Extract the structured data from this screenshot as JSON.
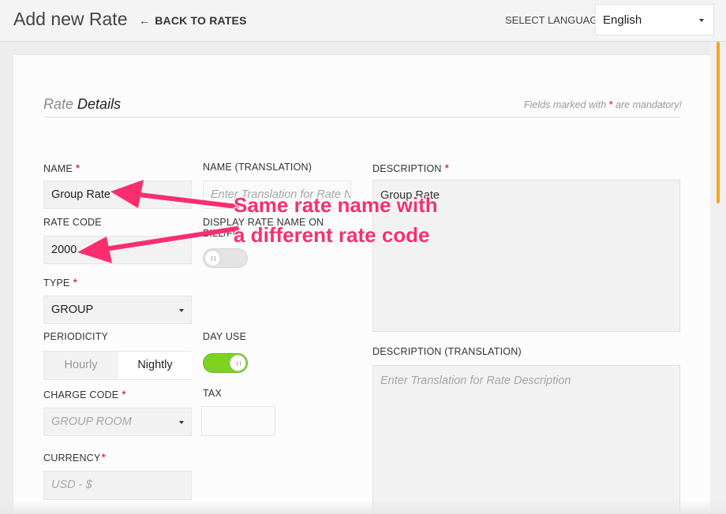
{
  "header": {
    "title": "Add new Rate",
    "back_label": "BACK TO RATES",
    "language_label": "SELECT LANGUAGE",
    "language_value": "English"
  },
  "section": {
    "title_light": "Rate",
    "title_bold": "Details",
    "mandatory_prefix": "Fields marked with",
    "mandatory_star": "*",
    "mandatory_suffix": "are mandatory!"
  },
  "form": {
    "name": {
      "label": "NAME",
      "value": "Group Rate"
    },
    "name_translation": {
      "label": "NAME (TRANSLATION)",
      "placeholder": "Enter Translation for Rate Na"
    },
    "rate_code": {
      "label": "RATE CODE",
      "value": "2000"
    },
    "display_rate_name": {
      "label_line1": "DISPLAY RATE NAME ON",
      "label_line2": "BILL/FO",
      "enabled": false
    },
    "type": {
      "label": "TYPE",
      "value": "GROUP"
    },
    "periodicity": {
      "label": "PERIODICITY",
      "options": [
        "Hourly",
        "Nightly"
      ],
      "selected": "Nightly"
    },
    "day_use": {
      "label": "DAY USE",
      "enabled": true
    },
    "charge_code": {
      "label": "CHARGE CODE",
      "placeholder": "GROUP ROOM"
    },
    "tax": {
      "label": "TAX",
      "value": ""
    },
    "currency": {
      "label": "CURRENCY",
      "placeholder": "USD - $"
    },
    "description": {
      "label": "DESCRIPTION",
      "value": "Group Rate"
    },
    "description_translation": {
      "label": "DESCRIPTION (TRANSLATION)",
      "placeholder": "Enter Translation for Rate Description"
    },
    "required_star": "*"
  },
  "annotation": {
    "line1": "Same rate name with",
    "line2": "a different rate code",
    "color": "#fa2e6e"
  },
  "colors": {
    "accent_scroll": "#f5a623",
    "toggle_on": "#7ed321",
    "required": "#d0021b"
  }
}
